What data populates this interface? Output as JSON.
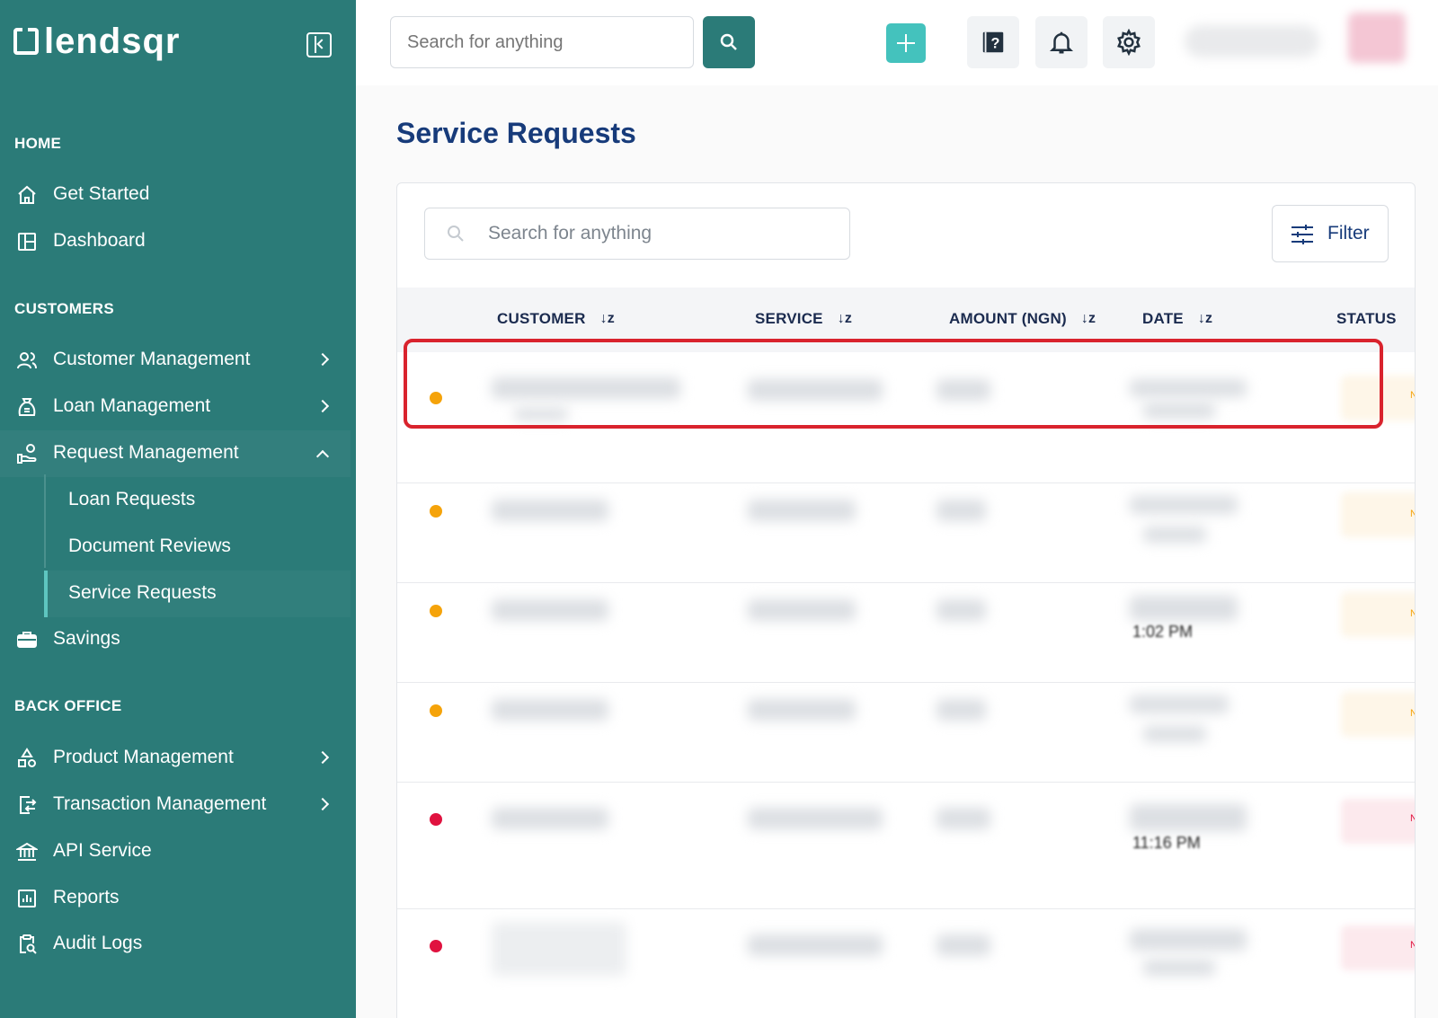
{
  "brand": {
    "name": "lendsqr"
  },
  "sidebar": {
    "sections": {
      "home": "HOME",
      "customers": "CUSTOMERS",
      "back_office": "BACK OFFICE"
    },
    "items": {
      "get_started": "Get Started",
      "dashboard": "Dashboard",
      "customer_management": "Customer Management",
      "loan_management": "Loan Management",
      "request_management": "Request Management",
      "loan_requests": "Loan Requests",
      "document_reviews": "Document Reviews",
      "service_requests": "Service Requests",
      "savings": "Savings",
      "product_management": "Product Management",
      "transaction_management": "Transaction Management",
      "api_service": "API Service",
      "reports": "Reports",
      "audit_logs": "Audit Logs"
    }
  },
  "topbar": {
    "search_placeholder": "Search for anything"
  },
  "page": {
    "title": "Service Requests",
    "search_placeholder": "Search for anything",
    "filter_label": "Filter"
  },
  "table": {
    "columns": [
      "CUSTOMER",
      "SERVICE",
      "AMOUNT (NGN)",
      "DATE",
      "STATUS"
    ],
    "sort_glyph": "↓z",
    "rows": [
      {
        "status_color": "#f5a30a",
        "status_letter": "N",
        "time_fragment": ""
      },
      {
        "status_color": "#f5a30a",
        "status_letter": "N",
        "time_fragment": ""
      },
      {
        "status_color": "#f5a30a",
        "status_letter": "N",
        "time_fragment": "1:02 PM"
      },
      {
        "status_color": "#f5a30a",
        "status_letter": "N",
        "time_fragment": ""
      },
      {
        "status_color": "#e0123f",
        "status_letter": "NE",
        "time_fragment": "11:16 PM"
      },
      {
        "status_color": "#e0123f",
        "status_letter": "NE",
        "time_fragment": ""
      }
    ]
  },
  "colors": {
    "sidebar": "#2b7b78",
    "accent": "#44c2bd",
    "title": "#173b7a",
    "highlight": "#d9232d"
  }
}
